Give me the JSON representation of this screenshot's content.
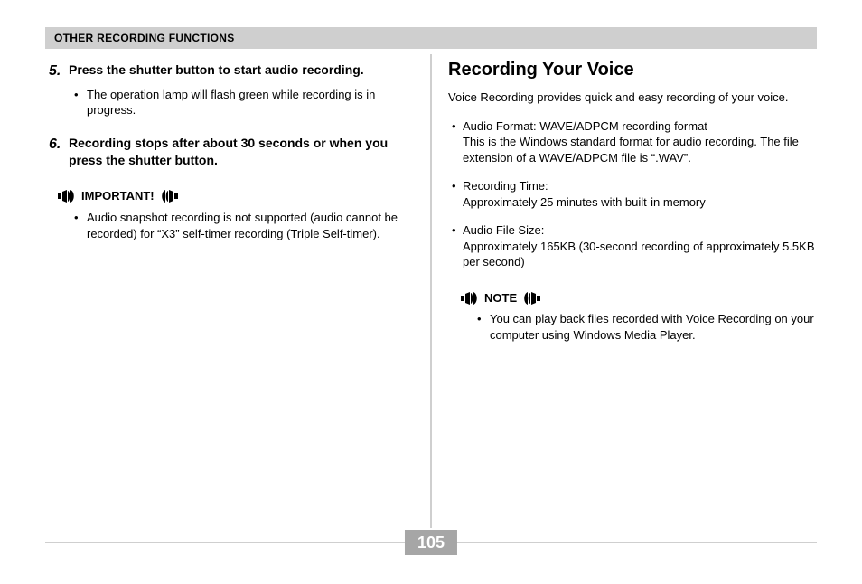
{
  "header": {
    "title": "OTHER RECORDING FUNCTIONS"
  },
  "left": {
    "steps": [
      {
        "num": "5.",
        "text": "Press the shutter button to start audio recording.",
        "bullets": [
          "The operation lamp will flash green while recording is in progress."
        ]
      },
      {
        "num": "6.",
        "text": "Recording stops after about 30 seconds or when you press the shutter button.",
        "bullets": []
      }
    ],
    "important": {
      "label": "IMPORTANT!",
      "bullets": [
        "Audio snapshot recording is not supported (audio cannot be recorded) for “X3” self-timer recording (Triple Self-timer)."
      ]
    }
  },
  "right": {
    "heading": "Recording Your Voice",
    "intro": "Voice Recording provides quick and easy recording of your voice.",
    "items": [
      "Audio Format: WAVE/ADPCM recording format\nThis is the Windows standard format for audio recording. The file extension of a WAVE/ADPCM file is “.WAV”.",
      "Recording Time:\nApproximately 25 minutes with built-in memory",
      "Audio File Size:\nApproximately 165KB (30-second recording of approximately 5.5KB per second)"
    ],
    "note": {
      "label": "NOTE",
      "bullets": [
        "You can play back files recorded with Voice Recording on your computer using Windows Media Player."
      ]
    }
  },
  "pageNumber": "105"
}
